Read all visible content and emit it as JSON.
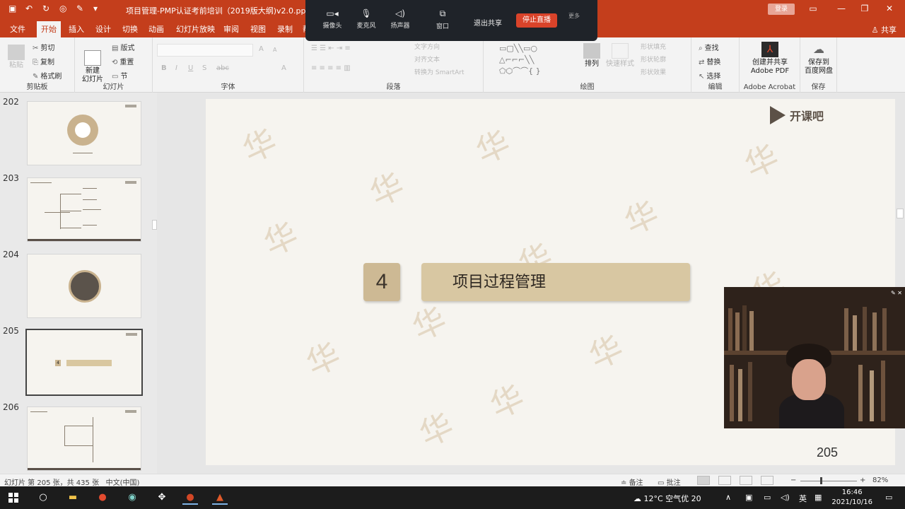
{
  "window": {
    "title": "项目管理-PMP认证考前培训（2019版大纲)v2.0.pptx [兼...",
    "signin_label": "登录",
    "share_label": "共享"
  },
  "tabs": [
    "文件",
    "开始",
    "插入",
    "设计",
    "切换",
    "动画",
    "幻灯片放映",
    "审阅",
    "视图",
    "录制",
    "帮"
  ],
  "active_tab": "开始",
  "meeting_bar": {
    "items": [
      {
        "icon": "camera-icon",
        "label": "摄像头"
      },
      {
        "icon": "mic-icon",
        "label": "麦克风"
      },
      {
        "icon": "speaker-icon",
        "label": "扬声器"
      },
      {
        "icon": "window-icon",
        "label": "窗口"
      }
    ],
    "exit_share": "退出共享",
    "stop_share": "停止直播",
    "more": "更多"
  },
  "ribbon": {
    "clipboard": {
      "cut": "剪切",
      "copy": "复制",
      "format_painter": "格式刷",
      "paste": "粘贴",
      "group": "剪贴板"
    },
    "slides": {
      "new_slide": "新建\n幻灯片",
      "layout": "版式",
      "reset": "重置",
      "section": "节",
      "group": "幻灯片"
    },
    "font": {
      "group": "字体",
      "bold": "B",
      "italic": "I",
      "underline": "U",
      "shadow": "S",
      "strike": "abc",
      "grow": "A",
      "shrink": "A"
    },
    "paragraph": {
      "group": "段落",
      "text_direction": "文字方向",
      "align_text": "对齐文本",
      "smartart": "转换为 SmartArt"
    },
    "drawing": {
      "group": "绘图",
      "arrange": "排列",
      "quick_styles": "快速样式",
      "fill": "形状填充",
      "outline": "形状轮廓",
      "effects": "形状效果"
    },
    "editing": {
      "group": "编辑",
      "find": "查找",
      "replace": "替换",
      "select": "选择"
    },
    "acrobat": {
      "group": "Adobe Acrobat",
      "create_share": "创建并共享",
      "adobe_pdf": "Adobe PDF"
    },
    "save": {
      "group": "保存",
      "save_to": "保存到",
      "baidu": "百度网盘"
    }
  },
  "slide_panel": {
    "slides": [
      {
        "number": "202",
        "selected": false
      },
      {
        "number": "203",
        "selected": false
      },
      {
        "number": "204",
        "selected": false
      },
      {
        "number": "205",
        "selected": true
      },
      {
        "number": "206",
        "selected": false
      }
    ],
    "thumb_205_num": "4"
  },
  "slide": {
    "logo_text": "开课吧",
    "section_number": "4",
    "section_title": "项目过程管理",
    "page_number": "205",
    "watermark_char": "华",
    "colors": {
      "background": "#f6f4ef",
      "number_box": "#cdb994",
      "title_box": "#d8c7a2"
    }
  },
  "statusbar": {
    "slide_info": "幻灯片 第 205 张，共 435 张",
    "language": "中文(中国)",
    "notes": "备注",
    "comments": "批注",
    "zoom": "82%"
  },
  "taskbar": {
    "weather": "12°C 空气优 20",
    "ime": "英",
    "time": "16:46",
    "date": "2021/10/16"
  },
  "theme": {
    "accent": "#c43e1c",
    "taskbar": "#1c1c1c"
  }
}
